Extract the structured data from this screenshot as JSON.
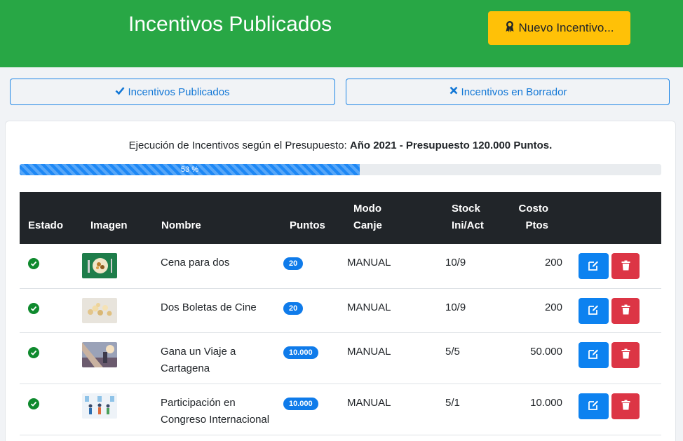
{
  "header": {
    "title": "Incentivos Publicados",
    "new_button": "Nuevo Incentivo...",
    "new_button_icon": "award-icon",
    "bg_color": "#28a745",
    "button_color": "#ffc107"
  },
  "filters": {
    "published_label": "Incentivos Publicados",
    "draft_label": "Incentivos en Borrador"
  },
  "budget": {
    "prefix": "Ejecución de Incentivos según el Presupuesto:",
    "bold": "Año 2021 - Presupuesto 120.000 Puntos.",
    "progress_label": "53 %",
    "progress_value": 0.53
  },
  "table": {
    "headers": {
      "estado": "Estado",
      "imagen": "Imagen",
      "nombre": "Nombre",
      "puntos": "Puntos",
      "modo": "Modo Canje",
      "stock": "Stock Ini/Act",
      "costo": "Costo Ptos"
    },
    "rows": [
      {
        "nombre": "Cena para dos",
        "puntos": "20",
        "modo": "MANUAL",
        "stock": "10/9",
        "costo": "200",
        "image": "food-image"
      },
      {
        "nombre": "Dos Boletas de Cine",
        "puntos": "20",
        "modo": "MANUAL",
        "stock": "10/9",
        "costo": "200",
        "image": "popcorn-image"
      },
      {
        "nombre": "Gana un Viaje a Cartagena",
        "puntos": "10.000",
        "modo": "MANUAL",
        "stock": "5/5",
        "costo": "50.000",
        "image": "travel-image"
      },
      {
        "nombre": "Participación en Congreso Internacional",
        "puntos": "10.000",
        "modo": "MANUAL",
        "stock": "5/1",
        "costo": "10.000",
        "image": "congress-image"
      }
    ]
  }
}
